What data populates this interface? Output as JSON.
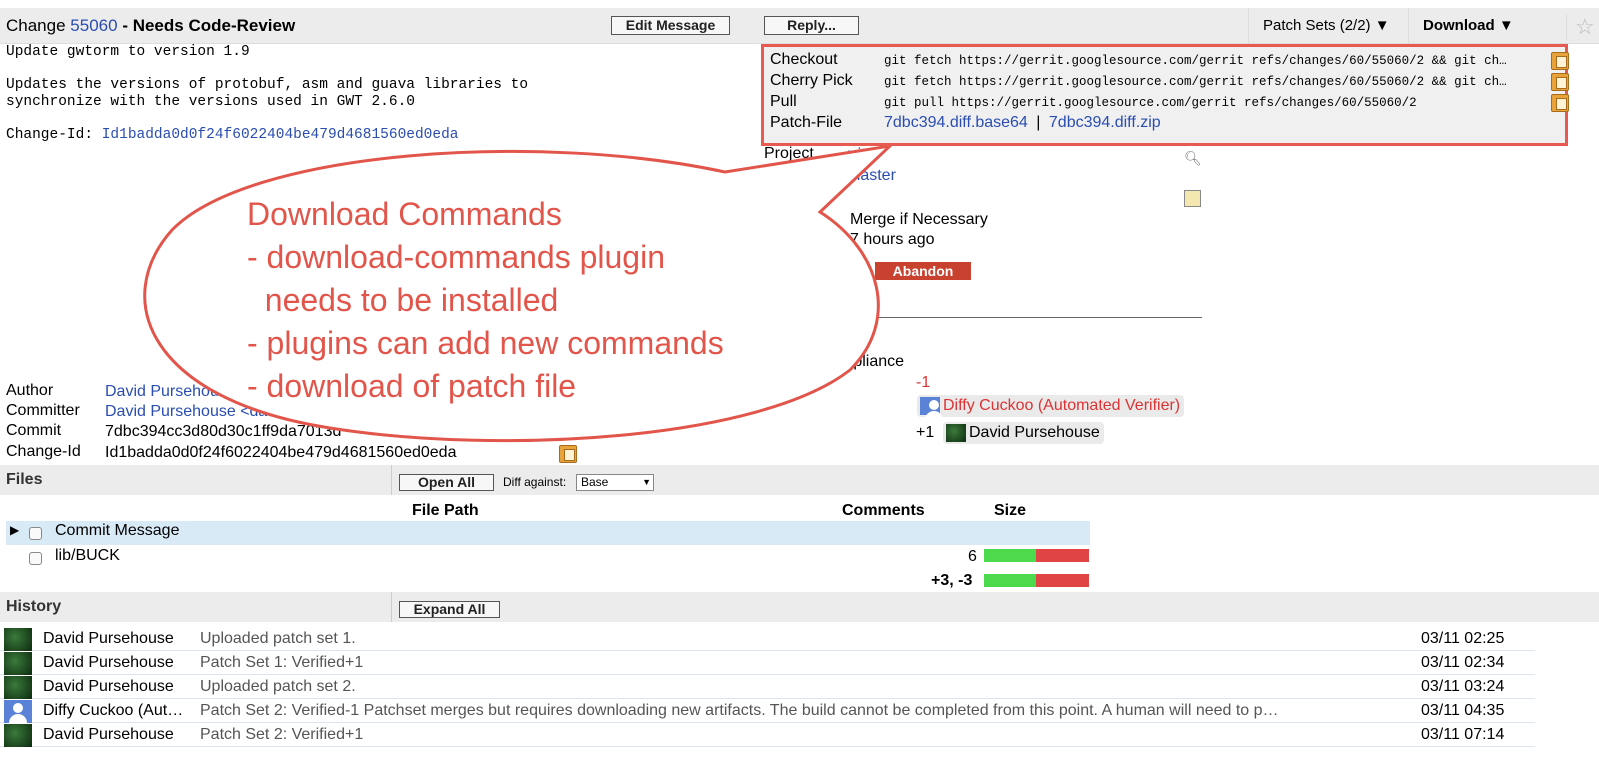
{
  "header": {
    "change_prefix": "Change",
    "change_number": "55060",
    "change_status": "- Needs Code-Review",
    "edit_message_label": "Edit Message",
    "reply_label": "Reply...",
    "patch_sets_label": "Patch Sets (2/2) ▼",
    "download_label": "Download ▼",
    "star_glyph": "☆"
  },
  "commit_message": {
    "body": "Update gwtorm to version 1.9\n\nUpdates the versions of protobuf, asm and guava libraries to\nsynchronize with the versions used in GWT 2.6.0\n",
    "change_id_label": "Change-Id:",
    "change_id_value": "Id1badda0d0f24f6022404be479d4681560ed0eda"
  },
  "download_panel": {
    "rows": [
      {
        "label": "Checkout",
        "command": "git fetch https://gerrit.googlesource.com/gerrit refs/changes/60/55060/2 && git ch…"
      },
      {
        "label": "Cherry Pick",
        "command": "git fetch https://gerrit.googlesource.com/gerrit refs/changes/60/55060/2 && git ch…"
      },
      {
        "label": "Pull",
        "command": "git pull https://gerrit.googlesource.com/gerrit refs/changes/60/55060/2"
      }
    ],
    "patch_file_label": "Patch-File",
    "patch_base64": "7dbc394.diff.base64",
    "patch_separator": "|",
    "patch_zip": "7dbc394.diff.zip"
  },
  "meta_right": {
    "project_label": "Project",
    "project_value": "rrit",
    "branch_value": "master",
    "strategy_value": "Merge if Necessary",
    "updated_value": "7 hours ago",
    "abandon_label": "Abandon",
    "compliance_label": "mpliance",
    "verified_label": "d",
    "verified_minus": "-1",
    "verifier_name": "Diffy Cuckoo (Automated Verifier)",
    "verified_plus": "+1",
    "plus_reviewer": "David Pursehouse"
  },
  "meta_left": {
    "author_label": "Author",
    "author_value": "David Pursehouse",
    "committer_label": "Committer",
    "committer_value": "David Pursehouse <dav",
    "commit_label": "Commit",
    "commit_value": "7dbc394cc3d80d30c1ff9da7013d",
    "change_id_label": "Change-Id",
    "change_id_value": "Id1badda0d0f24f6022404be479d4681560ed0eda"
  },
  "callout": {
    "text": "Download Commands\n- download-commands plugin\n  needs to be installed\n- plugins can add new commands\n- download of patch file"
  },
  "files": {
    "title": "Files",
    "open_all_label": "Open All",
    "diff_against_label": "Diff against:",
    "diff_against_value": "Base",
    "col_path": "File Path",
    "col_comments": "Comments",
    "col_size": "Size",
    "rows": [
      {
        "path": "Commit Message",
        "size": ""
      },
      {
        "path": "lib/BUCK",
        "size": "6"
      }
    ],
    "total": "+3, -3",
    "colors": {
      "added": "#4cd94c",
      "removed": "#e04444",
      "selected_row": "#d9eaf7"
    }
  },
  "history": {
    "title": "History",
    "expand_all_label": "Expand All",
    "rows": [
      {
        "name": "David Pursehouse",
        "message": "Uploaded patch set 1.",
        "date": "03/11 02:25",
        "avatar": "green"
      },
      {
        "name": "David Pursehouse",
        "message": "Patch Set 1: Verified+1",
        "date": "03/11 02:34",
        "avatar": "green"
      },
      {
        "name": "David Pursehouse",
        "message": "Uploaded patch set 2.",
        "date": "03/11 03:24",
        "avatar": "green"
      },
      {
        "name": "Diffy Cuckoo (Aut…",
        "message": "Patch Set 2: Verified-1 Patchset merges but requires downloading new artifacts. The build cannot be completed from this point. A human will need to p…",
        "date": "03/11 04:35",
        "avatar": "blue"
      },
      {
        "name": "David Pursehouse",
        "message": "Patch Set 2: Verified+1",
        "date": "03/11 07:14",
        "avatar": "green"
      }
    ]
  }
}
